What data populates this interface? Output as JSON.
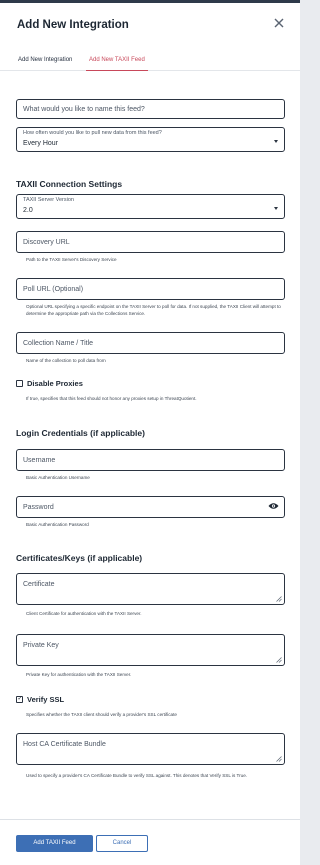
{
  "dialog": {
    "title": "Add New Integration"
  },
  "tabs": [
    {
      "label": "Add New Integration"
    },
    {
      "label": "Add New TAXII Feed"
    }
  ],
  "form": {
    "feed_name": {
      "placeholder": "What would you like to name this feed?"
    },
    "pull_frequency": {
      "label": "How often would you like to pull new data from this feed?",
      "value": "Every Hour"
    },
    "taxii_section": "TAXII Connection Settings",
    "server_version": {
      "label": "TAXII Server Version",
      "value": "2.0"
    },
    "discovery_url": {
      "placeholder": "Discovery URL",
      "helper": "Path to the TAXII Server's Discovery Service"
    },
    "poll_url": {
      "placeholder": "Poll URL (Optional)",
      "helper": "Optional URL specifying a specific endpoint on the TAXII Server to poll for data. If not supplied, the TAXII Client will attempt to determine the appropriate path via the Collections Service."
    },
    "collection_name": {
      "placeholder": "Collection Name / Title",
      "helper": "Name of the collection to poll data from"
    },
    "disable_proxies": {
      "label": "Disable Proxies",
      "checked": false,
      "helper": "If true, specifies that this feed should not honor any proxies setup in ThreatQuotient."
    },
    "login_section": "Login Credentials (if applicable)",
    "username": {
      "placeholder": "Username",
      "helper": "Basic Authentication Username"
    },
    "password": {
      "placeholder": "Password",
      "helper": "Basic Authentication Password"
    },
    "certs_section": "Certificates/Keys (if applicable)",
    "certificate": {
      "placeholder": "Certificate",
      "helper": "Client Certificate for authentication with the TAXII Server."
    },
    "private_key": {
      "placeholder": "Private Key",
      "helper": "Private Key for authentication with the TAXII Server."
    },
    "verify_ssl": {
      "label": "Verify SSL",
      "checked": true,
      "check_glyph": "✓",
      "helper": "Specifies whether the TAXII client should verify a provider's SSL certificate"
    },
    "host_ca_bundle": {
      "placeholder": "Host CA Certificate Bundle",
      "helper": "Used to specify a provider's CA Certificate Bundle to verify SSL against. This denotes that Verify SSL is True."
    }
  },
  "footer": {
    "primary_label": "Add TAXII Feed",
    "secondary_label": "Cancel"
  },
  "colors": {
    "accent": "#c8485a",
    "primary_button": "#3d6fb5",
    "border": "#2b3441"
  },
  "icons": [
    "close-icon",
    "eye-icon",
    "caret-down-icon",
    "resize-handle-icon",
    "check-icon"
  ]
}
